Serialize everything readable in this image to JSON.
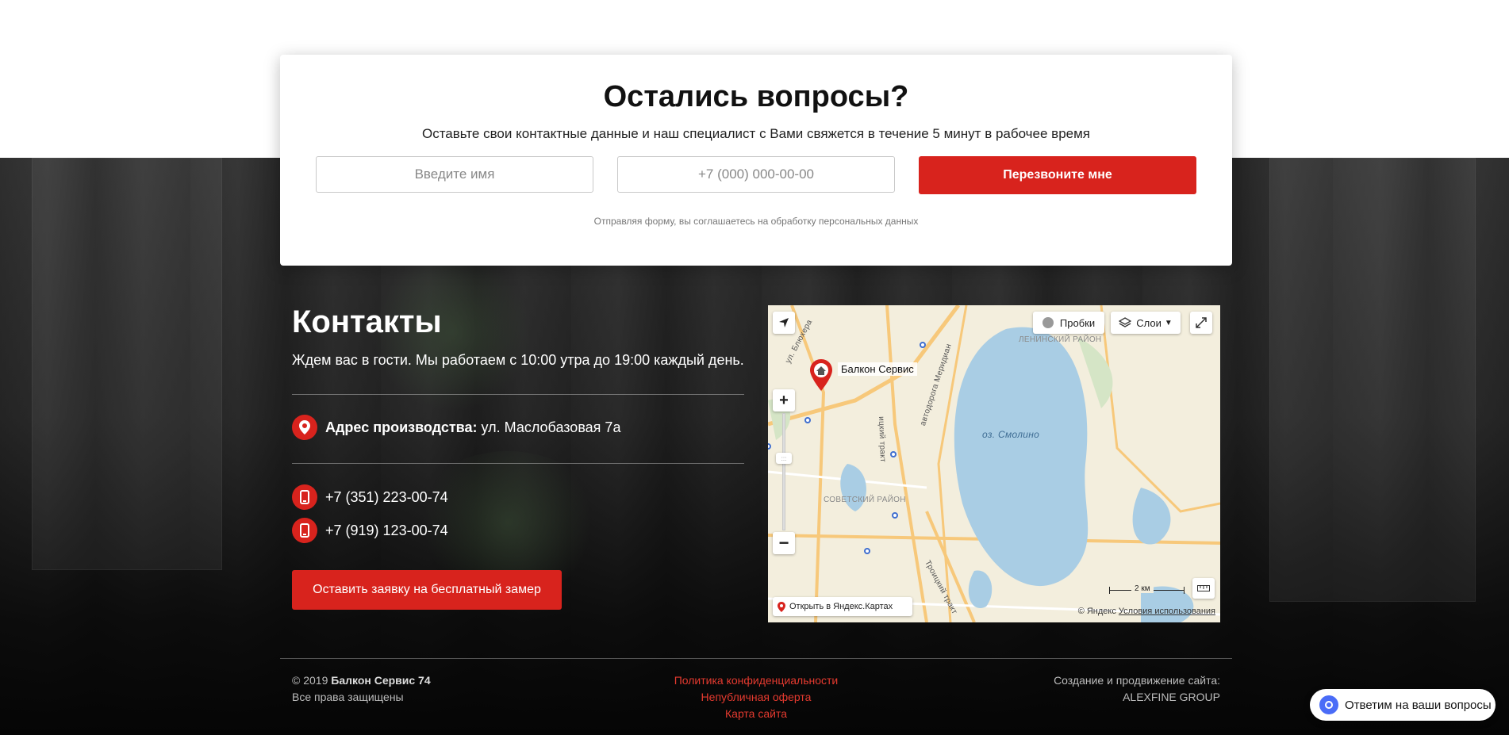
{
  "form": {
    "title": "Остались вопросы?",
    "subtitle": "Оставьте свои контактные данные и наш специалист с Вами свяжется в течение 5 минут в рабочее время",
    "name_placeholder": "Введите имя",
    "phone_placeholder": "+7 (000) 000-00-00",
    "submit_label": "Перезвоните мне",
    "agreement": "Отправляя форму, вы соглашаетесь на обработку персональных данных"
  },
  "contacts": {
    "title": "Контакты",
    "subtitle": "Ждем вас в гости. Мы работаем с 10:00 утра до 19:00 каждый день.",
    "address_label": "Адрес производства:",
    "address_value": "ул. Маслобазовая 7а",
    "phone1": "+7 (351) 223-00-74",
    "phone2": "+7 (919) 123-00-74",
    "cta_label": "Оставить заявку на бесплатный замер"
  },
  "map": {
    "traffic_label": "Пробки",
    "layers_label": "Слои",
    "marker_label": "Балкон Сервис",
    "open_label": "Открыть в Яндекс.Картах",
    "attribution": "© Яндекс",
    "terms": "Условия использования",
    "scale": "2 км",
    "labels": {
      "lake": "оз. Смолино",
      "district_lenin": "ЛЕНИНСКИЙ РАЙОН",
      "district_soviet": "СОВЕТСКИЙ РАЙОН",
      "street_blyukher": "ул. Блюхера",
      "street_meridian": "автодорога Меридиан",
      "street_troitsky": "Троицкий тракт",
      "street_troitsky_short": "ицкий тракт"
    },
    "colors": {
      "land": "#f3eedd",
      "water": "#a9cde4",
      "road": "#f7c87a"
    }
  },
  "footer": {
    "copyright_prefix": "© 2019",
    "company": "Балкон Сервис 74",
    "rights": "Все права защищены",
    "links": [
      "Политика конфиденциальности",
      "Непубличная оферта",
      "Карта сайта"
    ],
    "credit_line": "Создание и продвижение сайта:",
    "credit_name": "ALEXFINE GROUP"
  },
  "chat": {
    "label": "Ответим на ваши вопросы"
  },
  "colors": {
    "accent": "#d8231d",
    "link_red": "#e53a2f"
  }
}
